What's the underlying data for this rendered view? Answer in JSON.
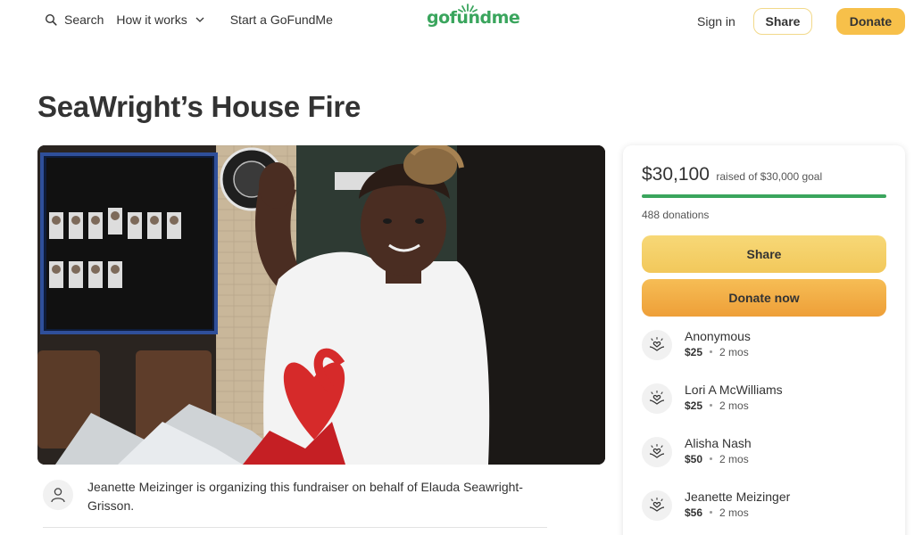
{
  "header": {
    "search_label": "Search",
    "how_it_works_label": "How it works",
    "start_label": "Start a GoFundMe",
    "logo_text": "gofundme",
    "sign_in_label": "Sign in",
    "share_label": "Share",
    "donate_label": "Donate"
  },
  "campaign": {
    "title": "SeaWright’s House Fire",
    "hero_image": "photo of a smiling woman in a white t-shirt with a red heart print, in a police station break room",
    "organizer_text": "Jeanette Meizinger is organizing this fundraiser on behalf of Elauda Seawright-Grisson."
  },
  "donation_card": {
    "raised_amount": "$30,100",
    "raised_suffix": "raised of $30,000 goal",
    "progress_fraction": 1.0,
    "donation_count": "488 donations",
    "share_label": "Share",
    "donate_now_label": "Donate now",
    "donors": [
      {
        "name": "Anonymous",
        "amount": "$25",
        "time": "2 mos"
      },
      {
        "name": "Lori A McWilliams",
        "amount": "$25",
        "time": "2 mos"
      },
      {
        "name": "Alisha Nash",
        "amount": "$50",
        "time": "2 mos"
      },
      {
        "name": "Jeanette Meizinger",
        "amount": "$56",
        "time": "2 mos"
      }
    ]
  },
  "colors": {
    "brand_green": "#3aa55d",
    "donate_yellow": "#f7c04a",
    "donate_orange": "#ee9f38"
  },
  "icons": [
    "search-icon",
    "chevron-down-icon",
    "user-icon",
    "heart-hands-icon"
  ]
}
